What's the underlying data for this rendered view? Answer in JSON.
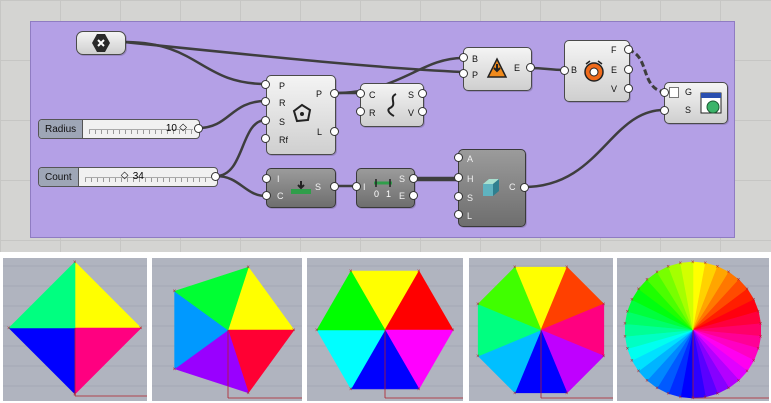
{
  "canvas": {
    "bg": "#d4d4d2",
    "group_color": "#b4a0e6"
  },
  "params": {
    "radius": {
      "label": "Radius",
      "value": "10"
    },
    "count": {
      "label": "Count",
      "value": "34"
    }
  },
  "components": {
    "polygon": {
      "icon": "polygon-icon",
      "inputs": [
        "P",
        "R",
        "S",
        "Rf"
      ],
      "outputs": [
        "P",
        "L"
      ]
    },
    "explode": {
      "icon": "explode-curve-icon",
      "inputs": [
        "C",
        "R"
      ],
      "outputs": [
        "S",
        "V"
      ]
    },
    "flip": {
      "icon": "flip-icon",
      "inputs": [
        "B",
        "P"
      ],
      "outputs": [
        "E"
      ]
    },
    "deconstruct_brep": {
      "icon": "deconstruct-brep-icon",
      "inputs": [
        "B"
      ],
      "outputs": [
        "F",
        "E",
        "V"
      ]
    },
    "series": {
      "icon": "series-icon",
      "inputs": [
        "I",
        "C"
      ],
      "outputs": [
        "S"
      ]
    },
    "remap": {
      "icon": "remap-numbers-icon",
      "inputs": [
        "I"
      ],
      "outputs": [
        "S",
        "E"
      ]
    },
    "colour_hsl": {
      "icon": "colour-cube-icon",
      "inputs": [
        "A",
        "H",
        "S",
        "L"
      ],
      "outputs": [
        "C"
      ]
    },
    "custom_preview": {
      "icon": "preview-icon",
      "inputs": [
        "G",
        "S"
      ]
    }
  },
  "previews": [
    {
      "name": "square",
      "sides": 4
    },
    {
      "name": "pentagon",
      "sides": 5
    },
    {
      "name": "hexagon",
      "sides": 6
    },
    {
      "name": "octagon",
      "sides": 8
    },
    {
      "name": "circle-34",
      "sides": 34
    }
  ]
}
